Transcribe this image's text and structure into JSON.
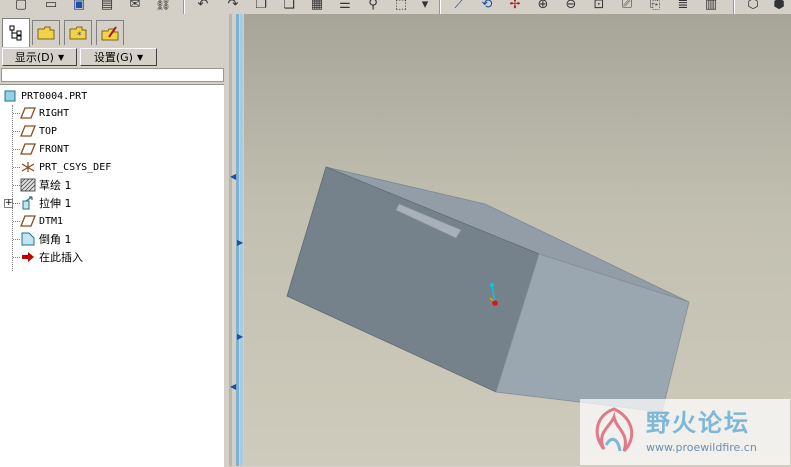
{
  "navigator": {
    "show_menu": "显示(D)",
    "settings_menu": "设置(G)",
    "filter_value": ""
  },
  "tree": {
    "items": [
      {
        "label": "PRT0004.PRT"
      },
      {
        "label": "RIGHT"
      },
      {
        "label": "TOP"
      },
      {
        "label": "FRONT"
      },
      {
        "label": "PRT_CSYS_DEF"
      },
      {
        "label": "草绘 1"
      },
      {
        "label": "拉伸 1",
        "expander": "+"
      },
      {
        "label": "DTM1"
      },
      {
        "label": "倒角 1"
      },
      {
        "label": "在此插入"
      }
    ]
  },
  "watermark": {
    "title": "野火论坛",
    "url": "www.proewildfire.cn"
  },
  "colors": {
    "tree_icon_brown": "#8b4a1c",
    "insert_arrow": "#c00000",
    "model_front": "#75818b",
    "model_top": "#939da7",
    "model_side": "#9aa6b0",
    "csys_cyan": "#00c8e0"
  }
}
